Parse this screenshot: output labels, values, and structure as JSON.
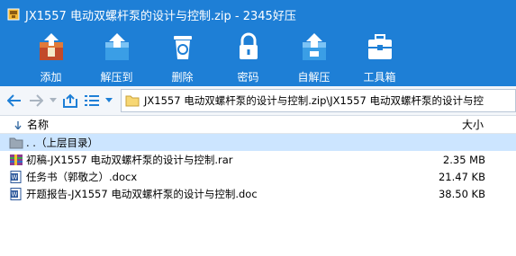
{
  "window": {
    "title": "JX1557 电动双螺杆泵的设计与控制.zip - 2345好压"
  },
  "toolbar": {
    "items": [
      {
        "label": "添加",
        "icon": "add-archive-icon"
      },
      {
        "label": "解压到",
        "icon": "extract-to-icon"
      },
      {
        "label": "删除",
        "icon": "recycle-bin-icon"
      },
      {
        "label": "密码",
        "icon": "lock-icon"
      },
      {
        "label": "自解压",
        "icon": "self-extract-icon"
      },
      {
        "label": "工具箱",
        "icon": "toolbox-icon"
      }
    ]
  },
  "navigation": {
    "path": "JX1557 电动双螺杆泵的设计与控制.zip\\JX1557 电动双螺杆泵的设计与控"
  },
  "columns": {
    "name": "名称",
    "size": "大小"
  },
  "files": [
    {
      "name": ". .（上层目录）",
      "size": "",
      "type": "parent-folder"
    },
    {
      "name": "初稿-JX1557 电动双螺杆泵的设计与控制.rar",
      "size": "2.35 MB",
      "type": "rar"
    },
    {
      "name": "任务书（郭敬之）.docx",
      "size": "21.47 KB",
      "type": "doc"
    },
    {
      "name": "开题报告-JX1557 电动双螺杆泵的设计与控制.doc",
      "size": "38.50 KB",
      "type": "doc"
    }
  ],
  "colors": {
    "accent": "#1e7fd6",
    "selection": "#cce5ff"
  }
}
